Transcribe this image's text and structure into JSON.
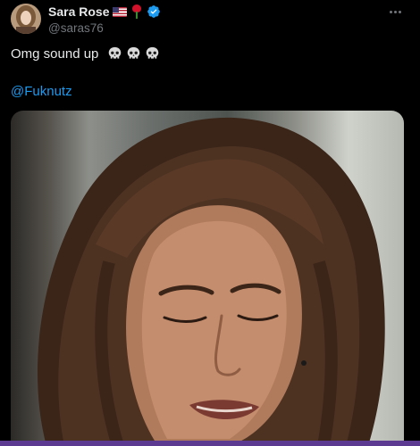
{
  "author": {
    "display_name": "Sara Rose",
    "handle": "@saras76",
    "name_badges": [
      "us-flag-icon",
      "rose-icon"
    ],
    "verified": true
  },
  "tweet": {
    "text": "Omg sound up",
    "emoji": [
      "skull-icon",
      "skull-icon",
      "skull-icon"
    ],
    "mention": "@Fuknutz"
  },
  "media": {
    "type": "video"
  },
  "colors": {
    "background": "#000000",
    "text": "#e7e9ea",
    "secondary_text": "#71767b",
    "link": "#1d9bf0",
    "verified_badge": "#1d9bf0"
  }
}
